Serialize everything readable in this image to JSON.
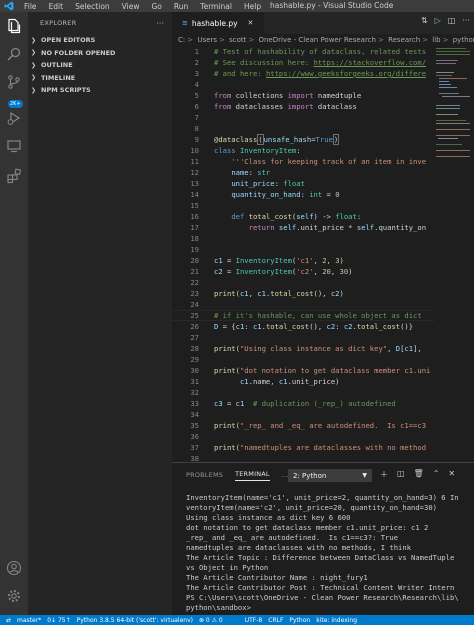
{
  "titlebar": {
    "menus": [
      "File",
      "Edit",
      "Selection",
      "View",
      "Go",
      "Run",
      "Terminal",
      "Help"
    ],
    "title": "hashable.py - Visual Studio Code"
  },
  "sidebar": {
    "title": "EXPLORER",
    "more": "···",
    "sections": [
      "OPEN EDITORS",
      "NO FOLDER OPENED",
      "OUTLINE",
      "TIMELINE",
      "NPM SCRIPTS"
    ]
  },
  "activity_badge": "2K+",
  "editor": {
    "tab_label": "hashable.py",
    "breadcrumb": [
      "C:",
      "Users",
      "scott",
      "OneDrive - Clean Power Research",
      "Research",
      "lib",
      "python",
      "san"
    ],
    "line_numbers": [
      "1",
      "2",
      "3",
      "4",
      "5",
      "6",
      "7",
      "8",
      "9",
      "10",
      "11",
      "12",
      "13",
      "14",
      "15",
      "16",
      "17",
      "18",
      "19",
      "20",
      "21",
      "22",
      "23",
      "24",
      "25",
      "26",
      "27",
      "28",
      "29",
      "30",
      "31",
      "32",
      "33",
      "34",
      "35",
      "36",
      "37",
      "38"
    ]
  },
  "panel": {
    "tabs": [
      "PROBLEMS",
      "TERMINAL",
      "..."
    ],
    "terminal_select": "2: Python",
    "terminal_lines": [
      "InventoryItem(name='c1', unit_price=2, quantity_on_hand=3) 6 In",
      "ventoryItem(name='c2', unit_price=20, quantity_on_hand=30)",
      "Using class instance as dict key 6 600",
      "dot notation to get dataclass member c1.unit_price: c1 2",
      "_rep_ and _eq_ are autodefined.  Is c1==c3?: True",
      "namedtuples are dataclasses with no methods, I think",
      "The Article Topic : Difference between DataClass vs NamedTuple",
      "vs Object in Python",
      "The Article Contributor Name : night_fury1",
      "The Article Contributor Post : Technical Content Writer Intern",
      "PS C:\\Users\\scott\\OneDrive - Clean Power Research\\Research\\lib\\",
      "python\\sandbox>"
    ]
  },
  "statusbar": {
    "branch": "master*",
    "sync": "0↓ 75↑",
    "interpreter": "Python 3.8.5 64-bit ('scott': virtualenv)",
    "problems": "⊗ 0 ⚠ 0",
    "encoding": "UTF-8",
    "eol": "CRLF",
    "language": "Python",
    "status": "kite: indexing"
  },
  "colors": {
    "accent": "#007acc",
    "keyword": "#569cd6",
    "string": "#ce9178",
    "comment": "#6a9955"
  }
}
